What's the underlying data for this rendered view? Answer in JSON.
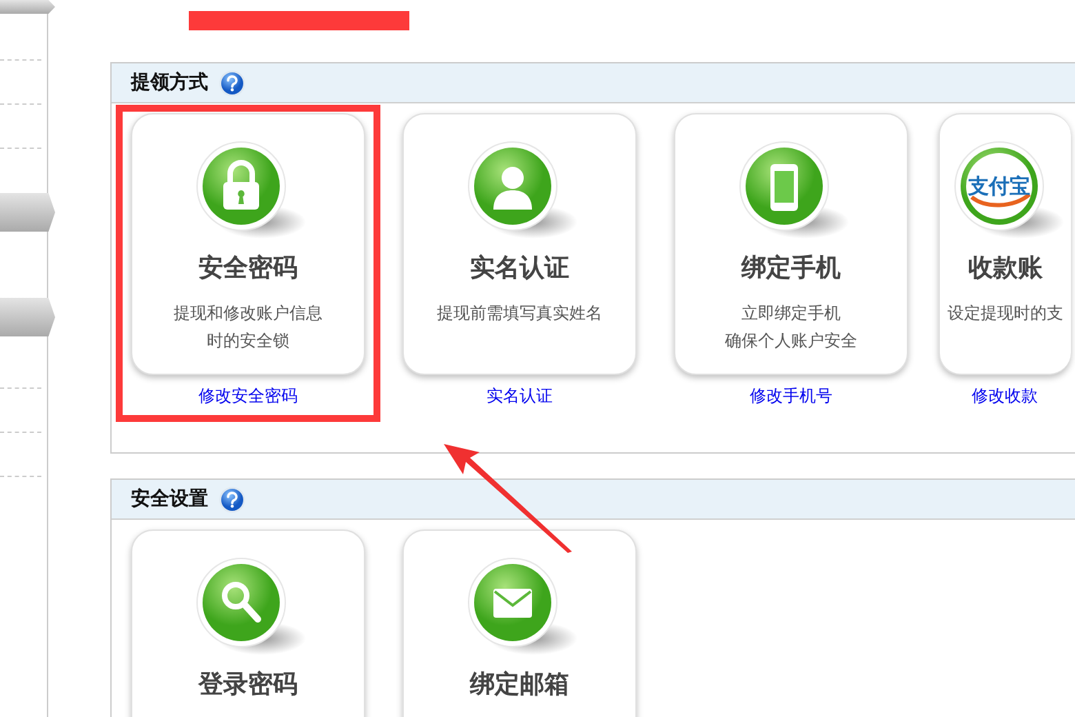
{
  "sections": [
    {
      "title": "提领方式",
      "cards": [
        {
          "kind": "lock",
          "title": "安全密码",
          "desc": [
            "提现和修改账户信息",
            "时的安全锁"
          ],
          "link": "修改安全密码",
          "highlighted": true
        },
        {
          "kind": "person",
          "title": "实名认证",
          "desc": [
            "提现前需填写真实姓名"
          ],
          "link": "实名认证",
          "highlighted": false
        },
        {
          "kind": "phone",
          "title": "绑定手机",
          "desc": [
            "立即绑定手机",
            "确保个人账户安全"
          ],
          "link": "修改手机号",
          "highlighted": false
        },
        {
          "kind": "logo",
          "logo_text": "支付宝",
          "title": "收款账",
          "desc": [
            "设定提现时的支"
          ],
          "link": "修改收款",
          "highlighted": false
        }
      ]
    },
    {
      "title": "安全设置",
      "cards": [
        {
          "kind": "search",
          "title": "登录密码",
          "highlighted": false
        },
        {
          "kind": "mail",
          "title": "绑定邮箱",
          "highlighted": false
        }
      ]
    }
  ]
}
